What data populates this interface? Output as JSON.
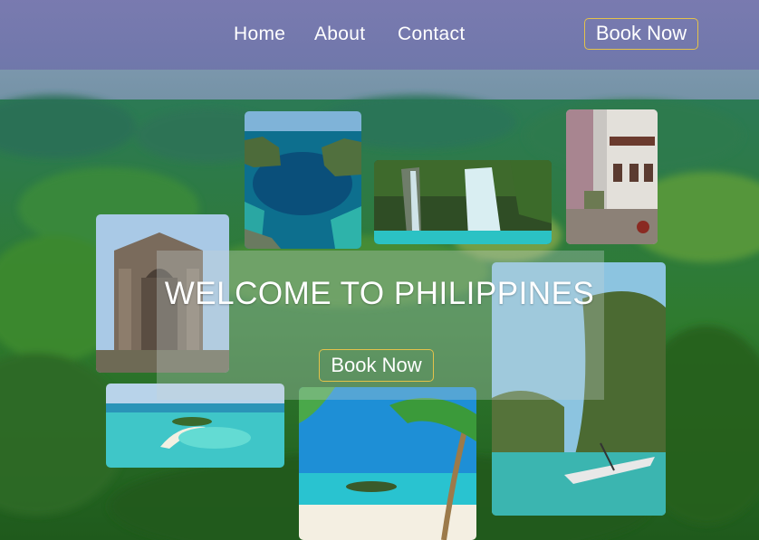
{
  "nav": {
    "links": [
      "Home",
      "About",
      "Contact"
    ],
    "book_label": "Book Now"
  },
  "hero": {
    "title": "WELCOME TO PHILIPPINES",
    "book_label": "Book Now"
  },
  "colors": {
    "nav_bg": "#7878af",
    "button_border": "#e4c24a",
    "text": "#ffffff"
  }
}
